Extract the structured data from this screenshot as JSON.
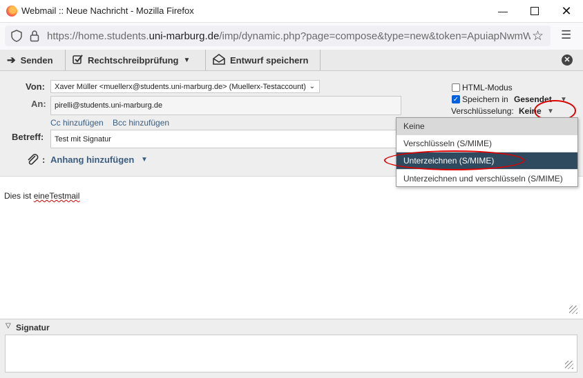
{
  "window": {
    "title": "Webmail :: Neue Nachricht - Mozilla Firefox",
    "minimize_icon": "minimize-icon",
    "maximize_icon": "maximize-icon",
    "close_icon": "close-icon"
  },
  "urlbar": {
    "prefix": "https://home.students.",
    "domain": "uni-marburg.de",
    "path": "/imp/dynamic.php?page=compose&type=new&token=ApuiapNwmWBAKv"
  },
  "toolbar": {
    "send_label": "Senden",
    "spell_label": "Rechtschreibprüfung",
    "draft_label": "Entwurf speichern"
  },
  "header": {
    "from_label": "Von:",
    "from_value": "Xaver Müller <muellerx@students.uni-marburg.de> (Muellerx-Testaccount)",
    "to_label": "An:",
    "to_value": "pirelli@students.uni-marburg.de",
    "cc_link": "Cc hinzufügen",
    "bcc_link": "Bcc hinzufügen",
    "subject_label": "Betreff:",
    "subject_value": "Test mit Signatur",
    "attach_colon": ":",
    "attach_label": "Anhang hinzufügen",
    "html_mode_label": "HTML-Modus",
    "html_mode_checked": false,
    "save_in_label": "Speichern in",
    "save_in_value": "Gesendet",
    "save_in_checked": true,
    "encryption_label": "Verschlüsselung:",
    "encryption_value": "Keine"
  },
  "encryption_menu": {
    "items": [
      "Keine",
      "Verschlüsseln (S/MIME)",
      "Unterzeichnen (S/MIME)",
      "Unterzeichnen und verschlüsseln (S/MIME)"
    ],
    "selected_index": 2
  },
  "body": {
    "text_prefix": "Dies ist ",
    "text_misspelled": "eineTestmail"
  },
  "signature": {
    "label": "Signatur",
    "value": ""
  },
  "colors": {
    "highlight": "#2f4a5e",
    "annotation_red": "#dd0000",
    "link": "#3a5d80"
  }
}
